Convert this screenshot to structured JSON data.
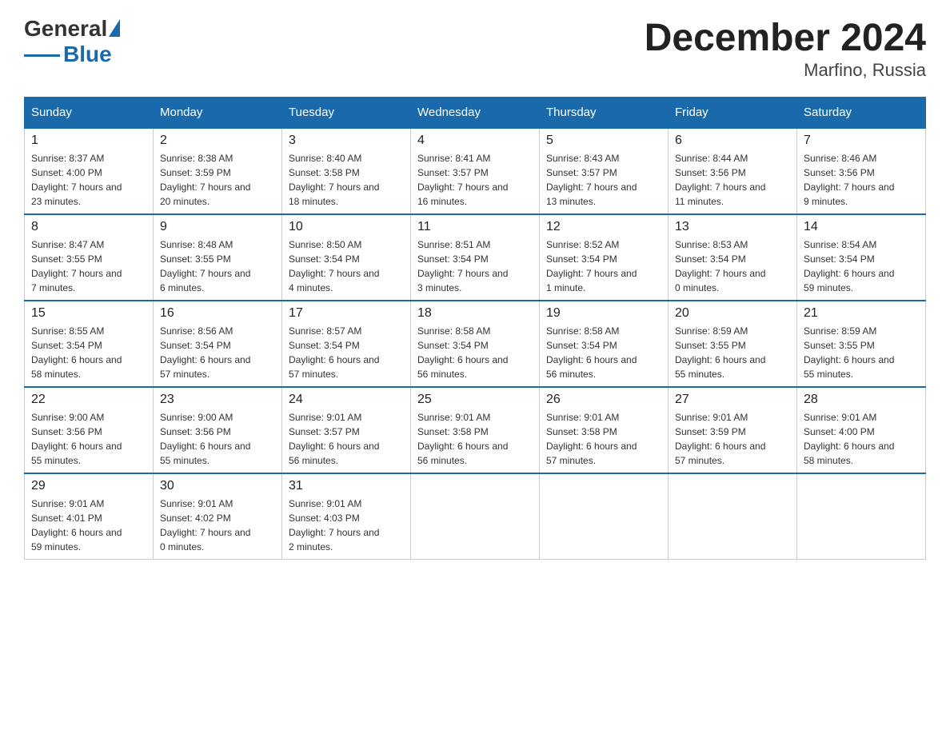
{
  "header": {
    "logo_general": "General",
    "logo_blue": "Blue",
    "month_title": "December 2024",
    "location": "Marfino, Russia"
  },
  "days_of_week": [
    "Sunday",
    "Monday",
    "Tuesday",
    "Wednesday",
    "Thursday",
    "Friday",
    "Saturday"
  ],
  "weeks": [
    [
      {
        "day": "1",
        "sunrise": "8:37 AM",
        "sunset": "4:00 PM",
        "daylight": "7 hours and 23 minutes."
      },
      {
        "day": "2",
        "sunrise": "8:38 AM",
        "sunset": "3:59 PM",
        "daylight": "7 hours and 20 minutes."
      },
      {
        "day": "3",
        "sunrise": "8:40 AM",
        "sunset": "3:58 PM",
        "daylight": "7 hours and 18 minutes."
      },
      {
        "day": "4",
        "sunrise": "8:41 AM",
        "sunset": "3:57 PM",
        "daylight": "7 hours and 16 minutes."
      },
      {
        "day": "5",
        "sunrise": "8:43 AM",
        "sunset": "3:57 PM",
        "daylight": "7 hours and 13 minutes."
      },
      {
        "day": "6",
        "sunrise": "8:44 AM",
        "sunset": "3:56 PM",
        "daylight": "7 hours and 11 minutes."
      },
      {
        "day": "7",
        "sunrise": "8:46 AM",
        "sunset": "3:56 PM",
        "daylight": "7 hours and 9 minutes."
      }
    ],
    [
      {
        "day": "8",
        "sunrise": "8:47 AM",
        "sunset": "3:55 PM",
        "daylight": "7 hours and 7 minutes."
      },
      {
        "day": "9",
        "sunrise": "8:48 AM",
        "sunset": "3:55 PM",
        "daylight": "7 hours and 6 minutes."
      },
      {
        "day": "10",
        "sunrise": "8:50 AM",
        "sunset": "3:54 PM",
        "daylight": "7 hours and 4 minutes."
      },
      {
        "day": "11",
        "sunrise": "8:51 AM",
        "sunset": "3:54 PM",
        "daylight": "7 hours and 3 minutes."
      },
      {
        "day": "12",
        "sunrise": "8:52 AM",
        "sunset": "3:54 PM",
        "daylight": "7 hours and 1 minute."
      },
      {
        "day": "13",
        "sunrise": "8:53 AM",
        "sunset": "3:54 PM",
        "daylight": "7 hours and 0 minutes."
      },
      {
        "day": "14",
        "sunrise": "8:54 AM",
        "sunset": "3:54 PM",
        "daylight": "6 hours and 59 minutes."
      }
    ],
    [
      {
        "day": "15",
        "sunrise": "8:55 AM",
        "sunset": "3:54 PM",
        "daylight": "6 hours and 58 minutes."
      },
      {
        "day": "16",
        "sunrise": "8:56 AM",
        "sunset": "3:54 PM",
        "daylight": "6 hours and 57 minutes."
      },
      {
        "day": "17",
        "sunrise": "8:57 AM",
        "sunset": "3:54 PM",
        "daylight": "6 hours and 57 minutes."
      },
      {
        "day": "18",
        "sunrise": "8:58 AM",
        "sunset": "3:54 PM",
        "daylight": "6 hours and 56 minutes."
      },
      {
        "day": "19",
        "sunrise": "8:58 AM",
        "sunset": "3:54 PM",
        "daylight": "6 hours and 56 minutes."
      },
      {
        "day": "20",
        "sunrise": "8:59 AM",
        "sunset": "3:55 PM",
        "daylight": "6 hours and 55 minutes."
      },
      {
        "day": "21",
        "sunrise": "8:59 AM",
        "sunset": "3:55 PM",
        "daylight": "6 hours and 55 minutes."
      }
    ],
    [
      {
        "day": "22",
        "sunrise": "9:00 AM",
        "sunset": "3:56 PM",
        "daylight": "6 hours and 55 minutes."
      },
      {
        "day": "23",
        "sunrise": "9:00 AM",
        "sunset": "3:56 PM",
        "daylight": "6 hours and 55 minutes."
      },
      {
        "day": "24",
        "sunrise": "9:01 AM",
        "sunset": "3:57 PM",
        "daylight": "6 hours and 56 minutes."
      },
      {
        "day": "25",
        "sunrise": "9:01 AM",
        "sunset": "3:58 PM",
        "daylight": "6 hours and 56 minutes."
      },
      {
        "day": "26",
        "sunrise": "9:01 AM",
        "sunset": "3:58 PM",
        "daylight": "6 hours and 57 minutes."
      },
      {
        "day": "27",
        "sunrise": "9:01 AM",
        "sunset": "3:59 PM",
        "daylight": "6 hours and 57 minutes."
      },
      {
        "day": "28",
        "sunrise": "9:01 AM",
        "sunset": "4:00 PM",
        "daylight": "6 hours and 58 minutes."
      }
    ],
    [
      {
        "day": "29",
        "sunrise": "9:01 AM",
        "sunset": "4:01 PM",
        "daylight": "6 hours and 59 minutes."
      },
      {
        "day": "30",
        "sunrise": "9:01 AM",
        "sunset": "4:02 PM",
        "daylight": "7 hours and 0 minutes."
      },
      {
        "day": "31",
        "sunrise": "9:01 AM",
        "sunset": "4:03 PM",
        "daylight": "7 hours and 2 minutes."
      },
      null,
      null,
      null,
      null
    ]
  ]
}
